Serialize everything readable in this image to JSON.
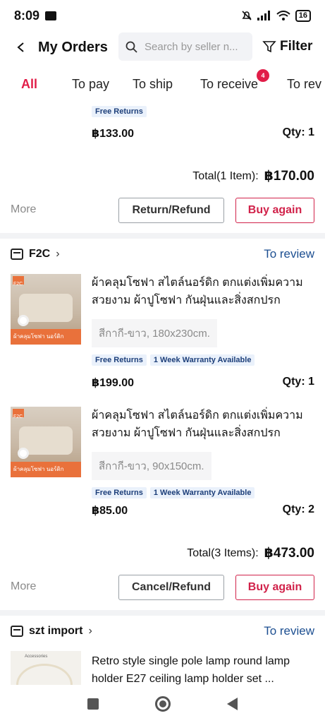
{
  "status_bar": {
    "time": "8:09",
    "battery": "16"
  },
  "header": {
    "title": "My Orders",
    "search_placeholder": "Search by seller n...",
    "filter_label": "Filter"
  },
  "tabs": [
    {
      "label": "All",
      "active": true
    },
    {
      "label": "To pay"
    },
    {
      "label": "To ship"
    },
    {
      "label": "To receive",
      "badge": "4"
    },
    {
      "label": "To rev"
    }
  ],
  "order1": {
    "tag": "Free Returns",
    "price": "฿133.00",
    "qty": "Qty: 1",
    "total_label": "Total(1 Item):",
    "total_value": "฿170.00",
    "more_label": "More",
    "secondary_button": "Return/Refund",
    "primary_button": "Buy again"
  },
  "order2": {
    "store": "F2C",
    "status": "To review",
    "items": [
      {
        "title": "ผ้าคลุมโซฟา สไตล์นอร์ดิก ตกแต่งเพิ่มความสวยงาม ผ้าปูโซฟา กันฝุ่นและสิ่งสกปรก",
        "thumb_banner": "ผ้าคลุมโซฟา นอร์ดิก",
        "thumb_logo": "F2C",
        "variant": "สีกากี-ขาว, 180x230cm.",
        "tag1": "Free Returns",
        "tag2": "1 Week Warranty Available",
        "price": "฿199.00",
        "qty": "Qty: 1"
      },
      {
        "title": "ผ้าคลุมโซฟา สไตล์นอร์ดิก ตกแต่งเพิ่มความสวยงาม ผ้าปูโซฟา กันฝุ่นและสิ่งสกปรก",
        "thumb_banner": "ผ้าคลุมโซฟา นอร์ดิก",
        "thumb_logo": "F2C",
        "variant": "สีกากี-ขาว, 90x150cm.",
        "tag1": "Free Returns",
        "tag2": "1 Week Warranty Available",
        "price": "฿85.00",
        "qty": "Qty: 2"
      }
    ],
    "total_label": "Total(3 Items):",
    "total_value": "฿473.00",
    "more_label": "More",
    "secondary_button": "Cancel/Refund",
    "primary_button": "Buy again"
  },
  "order3": {
    "store": "szt import",
    "status": "To review",
    "item_title": "Retro style single pole lamp round lamp holder E27 ceiling lamp holder set ...",
    "thumb_label": "Accessories"
  },
  "colors": {
    "accent": "#e11d48",
    "link": "#1d4f91",
    "tag_bg": "#eaf1fb"
  }
}
